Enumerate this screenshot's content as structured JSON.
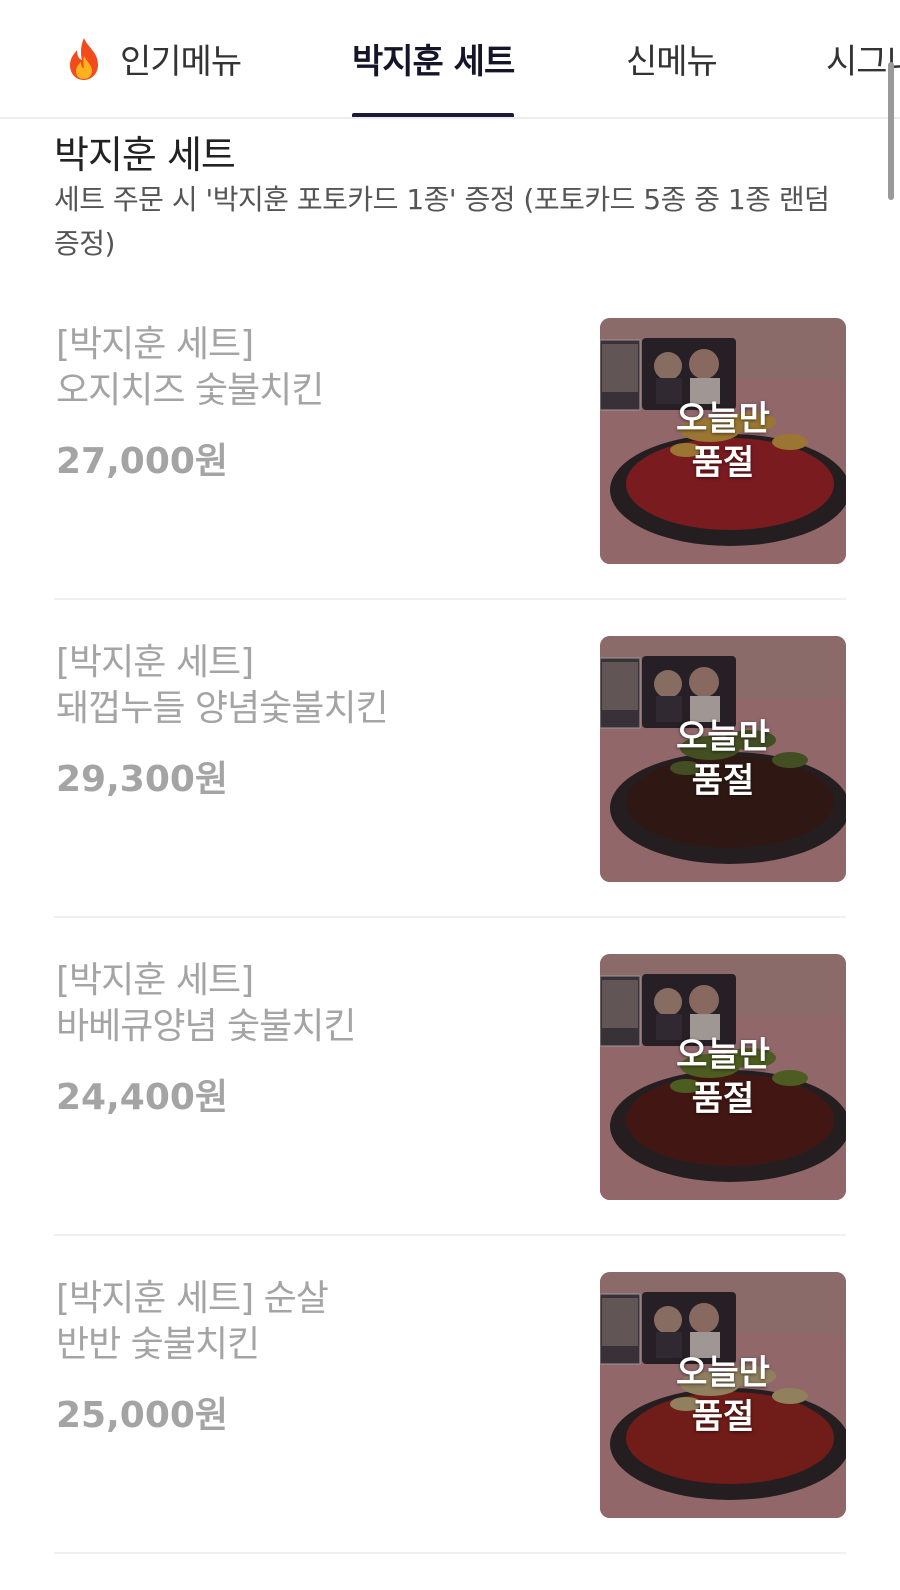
{
  "tabs": [
    {
      "label": "인기메뉴",
      "icon": "fire-icon",
      "active": false
    },
    {
      "label": "박지훈 세트",
      "active": true
    },
    {
      "label": "신메뉴",
      "active": false
    },
    {
      "label": "시그니",
      "active": false
    }
  ],
  "section": {
    "title": "박지훈 세트",
    "description": "세트 주문 시 '박지훈 포토카드 1종' 증정  (포토카드 5종 중 1종 랜덤 증정)"
  },
  "items": [
    {
      "name": "[박지훈 세트]\n오지치즈 숯불치킨",
      "price": "27,000원",
      "badge": "오늘만\n품절",
      "food_color": "#b3262a",
      "topping_color": "#e7b847"
    },
    {
      "name": "[박지훈 세트]\n돼껍누들 양념숯불치킨",
      "price": "29,300원",
      "badge": "오늘만\n품절",
      "food_color": "#3a2118",
      "topping_color": "#5b7a2e"
    },
    {
      "name": "[박지훈 세트]\n바베큐양념 숯불치킨",
      "price": "24,400원",
      "badge": "오늘만\n품절",
      "food_color": "#5a2015",
      "topping_color": "#6b8f2b"
    },
    {
      "name": "[박지훈 세트] 순살\n반반 숯불치킨",
      "price": "25,000원",
      "badge": "오늘만\n품절",
      "food_color": "#a3281e",
      "topping_color": "#d8c98f"
    }
  ],
  "colors": {
    "accent": "#1b1a3a",
    "muted_text": "#a4a4a4",
    "thumb_background": "#d9a0a2"
  }
}
